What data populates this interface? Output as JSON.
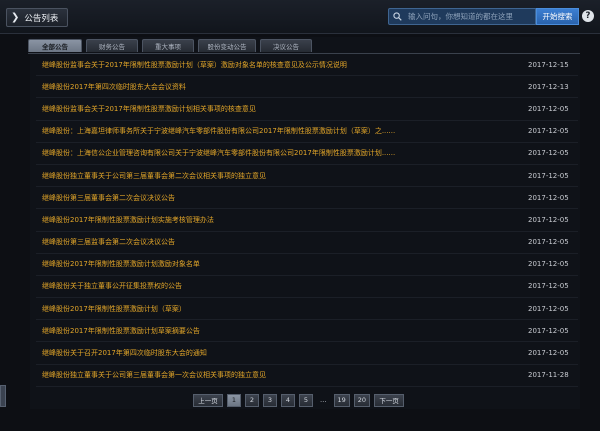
{
  "header": {
    "title": "公告列表",
    "search_placeholder": "输入问句，你想知道的都在这里",
    "search_button": "开始搜索",
    "help": "?"
  },
  "tabs": [
    {
      "label": "全部公告",
      "active": true
    },
    {
      "label": "财务公告",
      "active": false
    },
    {
      "label": "重大事项",
      "active": false
    },
    {
      "label": "股份变动公告",
      "active": false
    },
    {
      "label": "决议公告",
      "active": false
    }
  ],
  "announcements": [
    {
      "title": "继峰股份监事会关于2017年限制性股票激励计划（草案）激励对象名单的核查意见及公示情况说明",
      "date": "2017-12-15"
    },
    {
      "title": "继峰股份2017年第四次临时股东大会会议资料",
      "date": "2017-12-13"
    },
    {
      "title": "继峰股份监事会关于2017年限制性股票激励计划相关事项的核查意见",
      "date": "2017-12-05"
    },
    {
      "title": "继峰股份：上海嘉坦律师事务所关于宁波继峰汽车零部件股份有限公司2017年限制性股票激励计划（草案）之......",
      "date": "2017-12-05"
    },
    {
      "title": "继峰股份：上海信公企业管理咨询有限公司关于宁波继峰汽车零部件股份有限公司2017年限制性股票激励计划......",
      "date": "2017-12-05"
    },
    {
      "title": "继峰股份独立董事关于公司第三届董事会第二次会议相关事项的独立意见",
      "date": "2017-12-05"
    },
    {
      "title": "继峰股份第三届董事会第二次会议决议公告",
      "date": "2017-12-05"
    },
    {
      "title": "继峰股份2017年限制性股票激励计划实施考核管理办法",
      "date": "2017-12-05"
    },
    {
      "title": "继峰股份第三届监事会第二次会议决议公告",
      "date": "2017-12-05"
    },
    {
      "title": "继峰股份2017年限制性股票激励计划激励对象名单",
      "date": "2017-12-05"
    },
    {
      "title": "继峰股份关于独立董事公开征集投票权的公告",
      "date": "2017-12-05"
    },
    {
      "title": "继峰股份2017年限制性股票激励计划（草案）",
      "date": "2017-12-05"
    },
    {
      "title": "继峰股份2017年限制性股票激励计划草案摘要公告",
      "date": "2017-12-05"
    },
    {
      "title": "继峰股份关于召开2017年第四次临时股东大会的通知",
      "date": "2017-12-05"
    },
    {
      "title": "继峰股份独立董事关于公司第三届董事会第一次会议相关事项的独立意见",
      "date": "2017-11-28"
    }
  ],
  "pager": {
    "prev": "上一页",
    "pages": [
      "1",
      "2",
      "3",
      "4",
      "5"
    ],
    "ellipsis": "…",
    "tail": [
      "19",
      "20"
    ],
    "next": "下一页",
    "current": "1"
  }
}
